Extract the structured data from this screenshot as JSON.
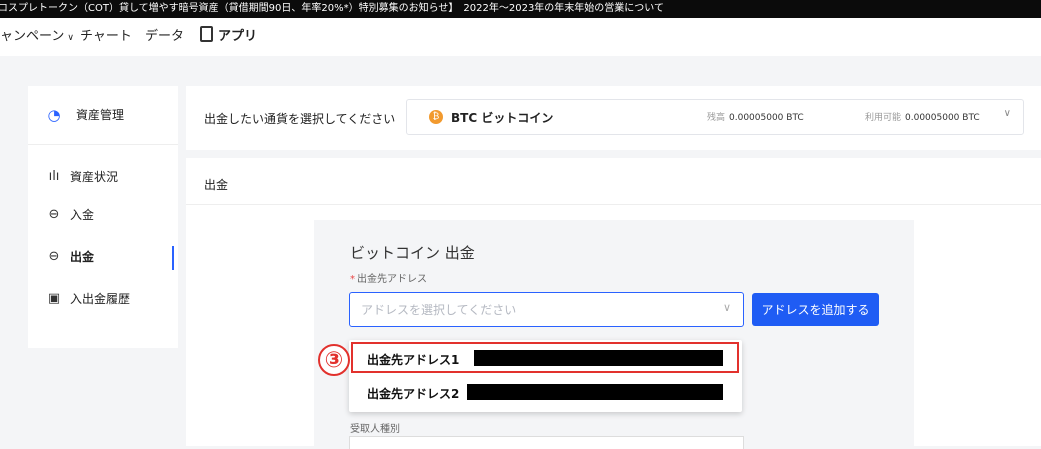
{
  "ticker": {
    "text": "コスプレトークン（COT）貸して増やす暗号資産（貸借期間90日、年率20%*）特別募集のお知らせ】　2022年～2023年の年末年始の営業について"
  },
  "topnav": {
    "items": [
      "ャンペーン",
      "チャート",
      "データ",
      "アプリ"
    ],
    "chevron": "∨"
  },
  "sidebar": {
    "header": {
      "icon": "pie-chart-icon",
      "label": "資産管理"
    },
    "items": [
      {
        "icon": "bar-chart-icon",
        "label": "資産状況",
        "active": false
      },
      {
        "icon": "deposit-arrow-icon",
        "label": "入金",
        "active": false
      },
      {
        "icon": "withdraw-arrow-icon",
        "label": "出金",
        "active": true
      },
      {
        "icon": "history-icon",
        "label": "入出金履歴",
        "active": false
      }
    ]
  },
  "currency": {
    "label": "出金したい通貨を選択してください",
    "selected": "BTC ビットコイン",
    "coin_symbol": "₿",
    "balance_label": "残高",
    "balance_value": "0.00005000 BTC",
    "available_label": "利用可能",
    "available_value": "0.00005000 BTC"
  },
  "withdraw": {
    "header": "出金",
    "form_title": "ビットコイン 出金",
    "address_label": "出金先アドレス",
    "required_mark": "*",
    "address_placeholder": "アドレスを選択してください",
    "add_address_button": "アドレスを追加する",
    "options": [
      {
        "name": "出金先アドレス1",
        "redacted": true,
        "highlighted": true
      },
      {
        "name": "出金先アドレス2",
        "redacted": true,
        "highlighted": false
      }
    ],
    "receiver_label": "受取人種別"
  },
  "annotation": {
    "step_number": "③",
    "color": "#e2312d"
  },
  "colors": {
    "accent": "#1f5cf4",
    "btc": "#f29a2e",
    "highlight": "#e2312d"
  }
}
